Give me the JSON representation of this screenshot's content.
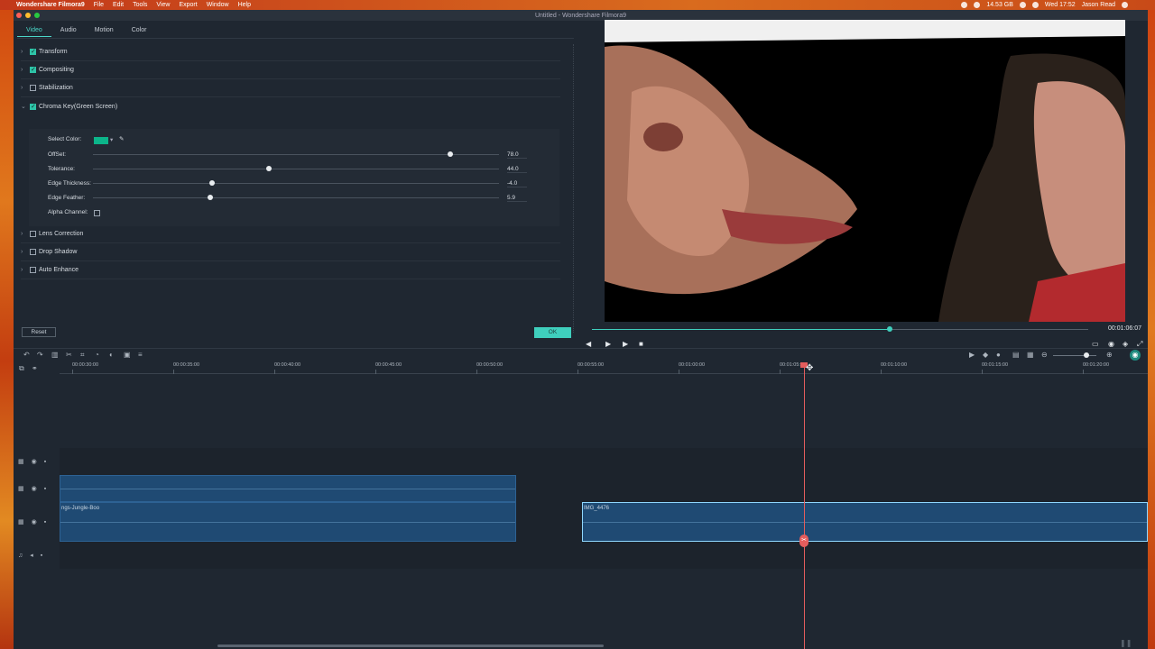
{
  "menubar": {
    "app_name": "Wondershare Filmora9",
    "items": [
      "File",
      "Edit",
      "Tools",
      "View",
      "Export",
      "Window",
      "Help"
    ],
    "storage": "14.53 GB",
    "clock": "Wed 17:52",
    "user": "Jason Read"
  },
  "window": {
    "title": "Untitled - Wondershare Filmora9"
  },
  "edit_panel": {
    "tabs": [
      "Video",
      "Audio",
      "Motion",
      "Color"
    ],
    "active_tab": "Video",
    "sections": {
      "transform": "Transform",
      "compositing": "Compositing",
      "stabilization": "Stabilization",
      "chroma_key": "Chroma Key(Green Screen)",
      "lens_correction": "Lens Correction",
      "drop_shadow": "Drop Shadow",
      "auto_enhance": "Auto Enhance"
    },
    "chroma": {
      "select_color_label": "Select Color:",
      "key_color": "#0cb58a",
      "offset_label": "OffSet:",
      "offset_value": "78.0",
      "tolerance_label": "Tolerance:",
      "tolerance_value": "44.0",
      "edge_thickness_label": "Edge Thickness:",
      "edge_thickness_value": "-4.0",
      "edge_feather_label": "Edge Feather:",
      "edge_feather_value": "5.9",
      "alpha_channel_label": "Alpha Channel:"
    },
    "reset_label": "Reset",
    "ok_label": "OK"
  },
  "player": {
    "timecode": "00:01:06:07",
    "progress": 0.6
  },
  "timeline": {
    "ruler": [
      "00:00:30:00",
      "00:00:35:00",
      "00:00:40:00",
      "00:00:45:00",
      "00:00:50:00",
      "00:00:55:00",
      "00:01:00:00",
      "00:01:05:00",
      "00:01:10:00",
      "00:01:15:00",
      "00:01:20:00"
    ],
    "clips": {
      "jungle": "ngs-Jungle-Boo",
      "img": "IMG_4476"
    }
  }
}
